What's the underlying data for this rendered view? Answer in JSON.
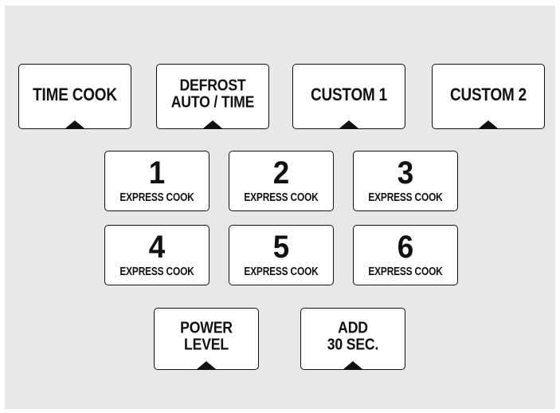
{
  "colors": {
    "panel_background": "#e8e8e8",
    "key_background": "#ffffff",
    "key_border": "#111111",
    "text": "#111111"
  },
  "top_row": [
    {
      "lines": [
        "TIME COOK"
      ],
      "indicator": "triangle-up-icon"
    },
    {
      "lines": [
        "DEFROST",
        "AUTO / TIME"
      ],
      "indicator": "triangle-up-icon"
    },
    {
      "lines": [
        "CUSTOM 1"
      ],
      "indicator": "triangle-up-icon"
    },
    {
      "lines": [
        "CUSTOM 2"
      ],
      "indicator": "triangle-up-icon"
    }
  ],
  "express_keys": [
    {
      "number": "1",
      "label": "EXPRESS COOK"
    },
    {
      "number": "2",
      "label": "EXPRESS COOK"
    },
    {
      "number": "3",
      "label": "EXPRESS COOK"
    },
    {
      "number": "4",
      "label": "EXPRESS COOK"
    },
    {
      "number": "5",
      "label": "EXPRESS COOK"
    },
    {
      "number": "6",
      "label": "EXPRESS COOK"
    }
  ],
  "bottom_row": [
    {
      "lines": [
        "POWER",
        "LEVEL"
      ],
      "indicator": "triangle-up-icon"
    },
    {
      "lines": [
        "ADD",
        "30 SEC."
      ],
      "indicator": "triangle-up-icon"
    }
  ]
}
